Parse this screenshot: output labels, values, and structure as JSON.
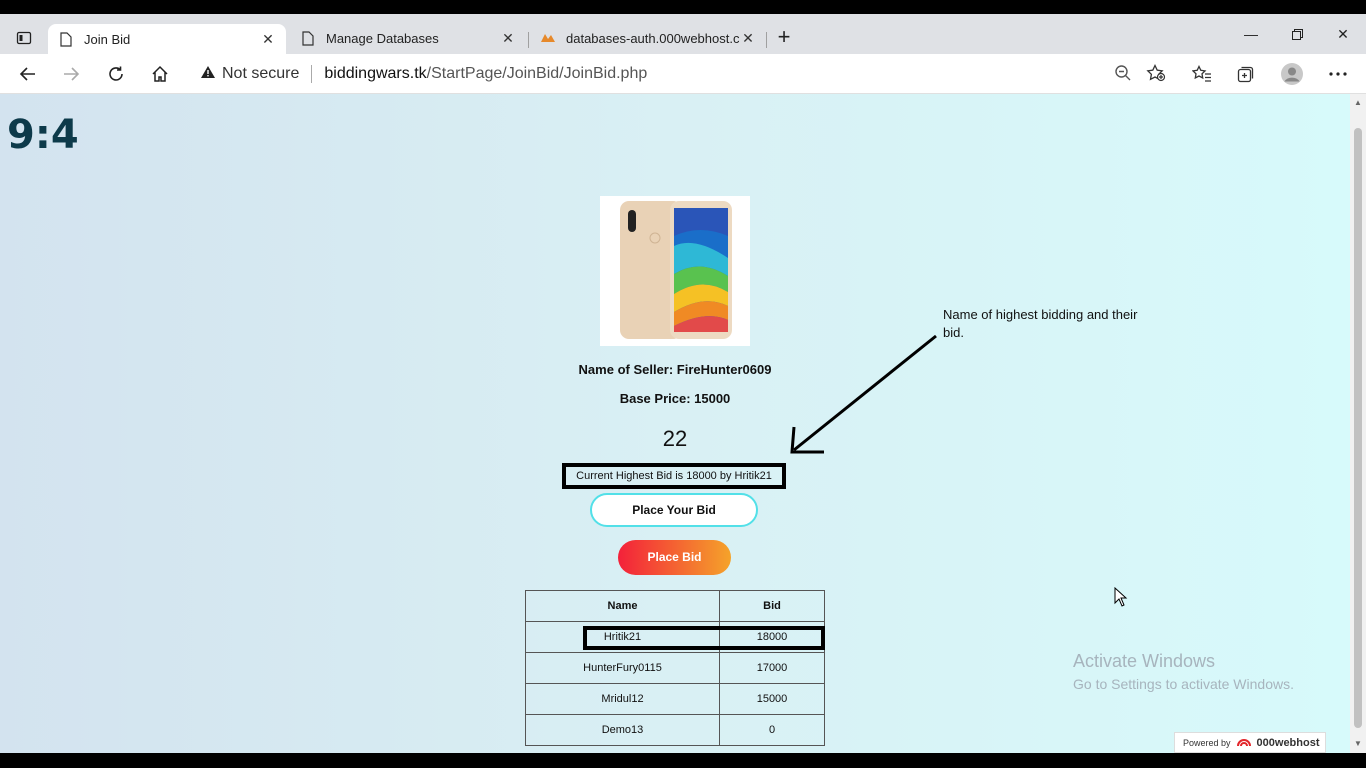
{
  "browser": {
    "tabs": [
      {
        "title": "Join Bid",
        "active": true
      },
      {
        "title": "Manage Databases",
        "active": false
      },
      {
        "title": "databases-auth.000webhost.com",
        "active": false
      }
    ],
    "address": {
      "security_label": "Not secure",
      "host": "biddingwars.tk",
      "path": "/StartPage/JoinBid/JoinBid.php"
    }
  },
  "page": {
    "ratio_label": "9:4",
    "seller_label": "Name of Seller: FireHunter0609",
    "base_price_label": "Base Price: 15000",
    "timer": "22",
    "highest_bid_label": "Current Highest Bid is 18000 by Hritik21",
    "bid_input_placeholder": "Place Your Bid",
    "place_bid_button": "Place Bid",
    "table": {
      "headers": [
        "Name",
        "Bid"
      ],
      "rows": [
        {
          "name": "Hritik21",
          "bid": "18000"
        },
        {
          "name": "HunterFury0115",
          "bid": "17000"
        },
        {
          "name": "Mridul12",
          "bid": "15000"
        },
        {
          "name": "Demo13",
          "bid": "0"
        }
      ]
    },
    "annotation": "Name of highest bidding and their bid."
  },
  "overlay": {
    "activate_title": "Activate Windows",
    "activate_sub": "Go to Settings to activate Windows.",
    "powered_by": "Powered by",
    "powered_brand": "000webhost"
  }
}
